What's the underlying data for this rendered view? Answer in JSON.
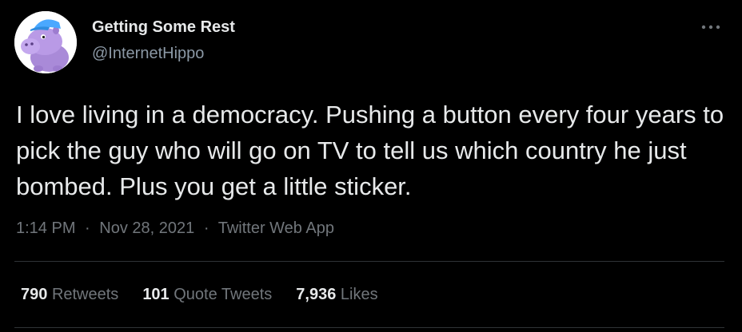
{
  "author": {
    "display_name": "Getting Some Rest",
    "handle": "@InternetHippo",
    "avatar_icon": "hippo-avatar-icon"
  },
  "menu": {
    "icon": "more-horizontal-icon"
  },
  "tweet": {
    "text": "I love living in a democracy. Pushing a button every four years to pick the guy who will go on TV to tell us which country he just bombed. Plus you get a little sticker."
  },
  "meta": {
    "time": "1:14 PM",
    "separator": "·",
    "date": "Nov 28, 2021",
    "source": "Twitter Web App"
  },
  "stats": {
    "retweets": {
      "count": "790",
      "label": "Retweets"
    },
    "quotes": {
      "count": "101",
      "label": "Quote Tweets"
    },
    "likes": {
      "count": "7,936",
      "label": "Likes"
    }
  },
  "colors": {
    "background": "#000000",
    "primary_text": "#e7e9ea",
    "secondary_text": "#71767b",
    "divider": "#2f3336",
    "avatar_hippo": "#b99ae6",
    "avatar_cap": "#4aa8ff"
  }
}
